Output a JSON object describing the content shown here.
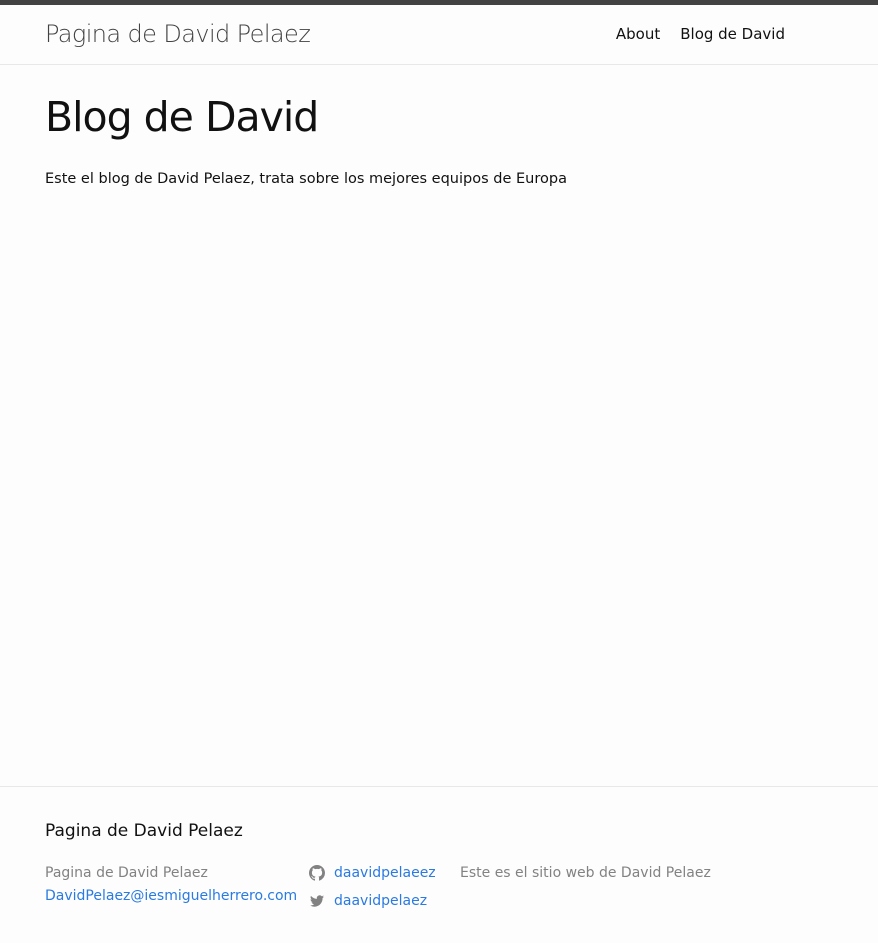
{
  "header": {
    "site_title": "Pagina de David Pelaez",
    "nav": [
      {
        "label": "About"
      },
      {
        "label": "Blog de David"
      }
    ]
  },
  "main": {
    "title": "Blog de David",
    "content": "Este el blog de David Pelaez, trata sobre los mejores equipos de Europa"
  },
  "footer": {
    "heading": "Pagina de David Pelaez",
    "name": "Pagina de David Pelaez",
    "email": "DavidPelaez@iesmiguelherrero.com",
    "social": [
      {
        "icon": "github-icon",
        "label": "daavidpelaeez"
      },
      {
        "icon": "twitter-icon",
        "label": "daavidpelaez"
      }
    ],
    "description": "Este es el sitio web de David Pelaez"
  },
  "colors": {
    "top_bar": "#424242",
    "link": "#2a7ae2",
    "muted_text": "#828282",
    "border": "#e8e8e8",
    "background": "#fdfdfd"
  }
}
